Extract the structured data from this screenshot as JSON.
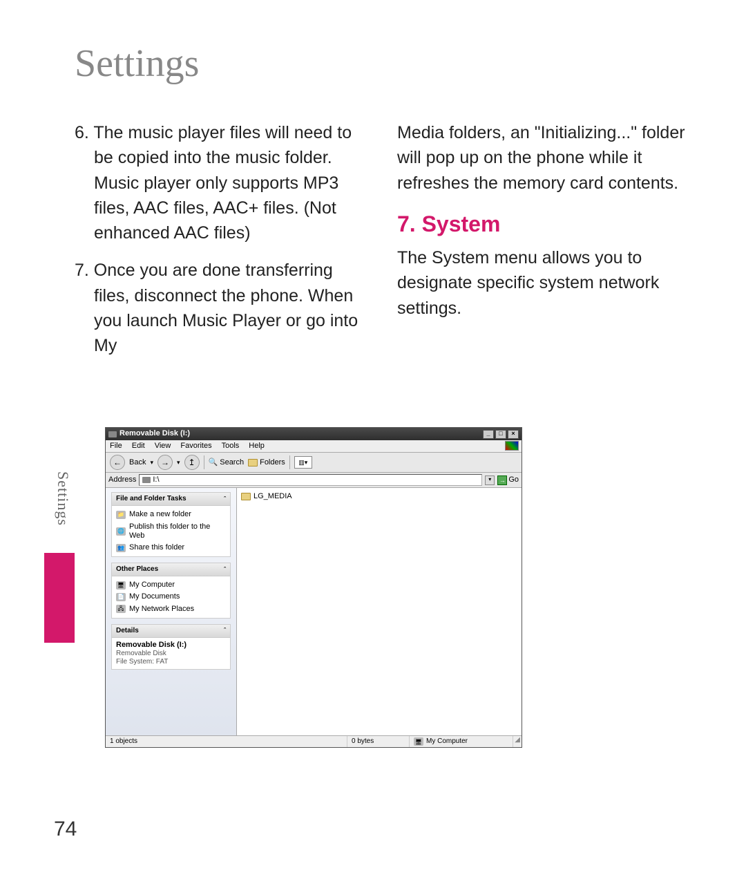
{
  "page_title": "Settings",
  "side_label": "Settings",
  "page_number": "74",
  "col1": {
    "p6": "6. The music player files will need to be copied into the music folder. Music player only supports MP3 files, AAC files, AAC+ files. (Not enhanced AAC files)",
    "p7": "7. Once you are done transferring files, disconnect the phone. When you launch Music Player or go into My"
  },
  "col2": {
    "cont": "Media folders, an \"Initializing...\" folder will pop up on the phone while it refreshes the memory card contents.",
    "heading": "7. System",
    "body": "The System menu allows you to designate specific system network settings."
  },
  "explorer": {
    "title": "Removable Disk (I:)",
    "menu": [
      "File",
      "Edit",
      "View",
      "Favorites",
      "Tools",
      "Help"
    ],
    "toolbar": {
      "back": "Back",
      "search": "Search",
      "folders": "Folders"
    },
    "address_label": "Address",
    "address_value": "I:\\",
    "go": "Go",
    "content_folder": "LG_MEDIA",
    "panes": {
      "tasks": {
        "title": "File and Folder Tasks",
        "items": [
          "Make a new folder",
          "Publish this folder to the Web",
          "Share this folder"
        ]
      },
      "places": {
        "title": "Other Places",
        "items": [
          "My Computer",
          "My Documents",
          "My Network Places"
        ]
      },
      "details": {
        "title": "Details",
        "line1": "Removable Disk (I:)",
        "line2": "Removable Disk",
        "line3": "File System: FAT"
      }
    },
    "status": {
      "objects": "1 objects",
      "size": "0 bytes",
      "location": "My Computer"
    }
  }
}
